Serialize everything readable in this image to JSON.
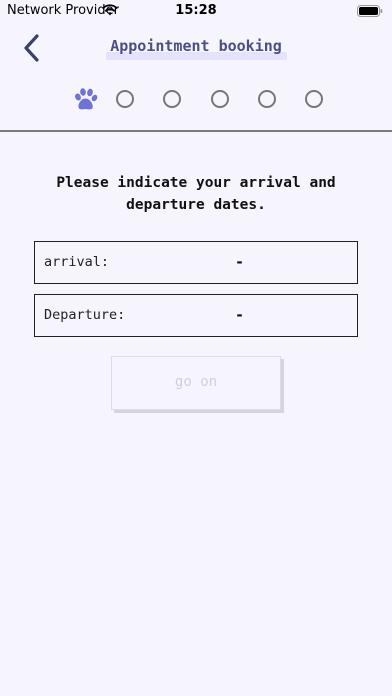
{
  "status_bar": {
    "carrier": "Network Provider",
    "time": "15:28",
    "wifi_icon": "wifi-icon",
    "battery_icon": "battery-icon"
  },
  "header": {
    "back_icon": "chevron-left-icon",
    "title": "Appointment booking"
  },
  "steps": {
    "current": 1,
    "total": 6,
    "current_icon": "paw-icon",
    "accent_color": "#6f73d8"
  },
  "form": {
    "prompt": "Please indicate your arrival and departure dates.",
    "arrival_label": "arrival:",
    "arrival_value": "-",
    "departure_label": "Departure:",
    "departure_value": "-",
    "submit_label": "go on"
  }
}
